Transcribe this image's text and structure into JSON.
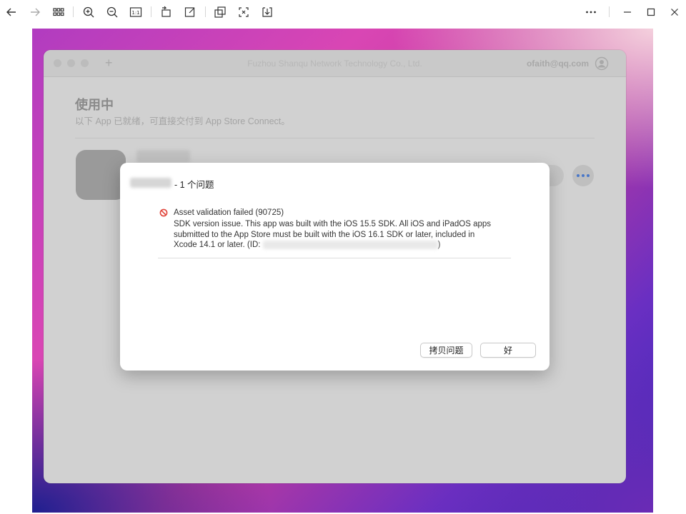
{
  "toolbar": {
    "icons": [
      "back-arrow-icon",
      "forward-arrow-icon",
      "grid-icon",
      "zoom-in-icon",
      "zoom-out-icon",
      "actual-size-icon",
      "rotate-icon",
      "edit-icon",
      "crop-icon",
      "fit-icon",
      "download-icon",
      "more-icon",
      "minimize-icon",
      "maximize-icon",
      "close-icon"
    ],
    "actual_size_label": "1:1"
  },
  "app_window": {
    "title": "Fuzhou Shanqu Network Technology Co., Ltd.",
    "account_email": "ofaith@qq.com",
    "add_tab_label": "+",
    "section_title": "使用中",
    "section_subtitle": "以下 App 已就绪，可直接交付到 App Store Connect。"
  },
  "dialog": {
    "title": "- 1 个问题",
    "issue": {
      "title": "Asset validation failed (90725)",
      "body_line1": "SDK version issue. This app was built with the iOS 15.5 SDK. All iOS and iPadOS apps",
      "body_line2": "submitted to the App Store must be built with the iOS 16.1 SDK or later, included in",
      "body_line3_prefix": "Xcode 14.1 or later. (ID: ",
      "body_line3_suffix": ")"
    },
    "copy_button_label": "拷贝问题",
    "ok_button_label": "好"
  },
  "colors": {
    "accent": "#4a78c8",
    "error": "#e0443a"
  }
}
